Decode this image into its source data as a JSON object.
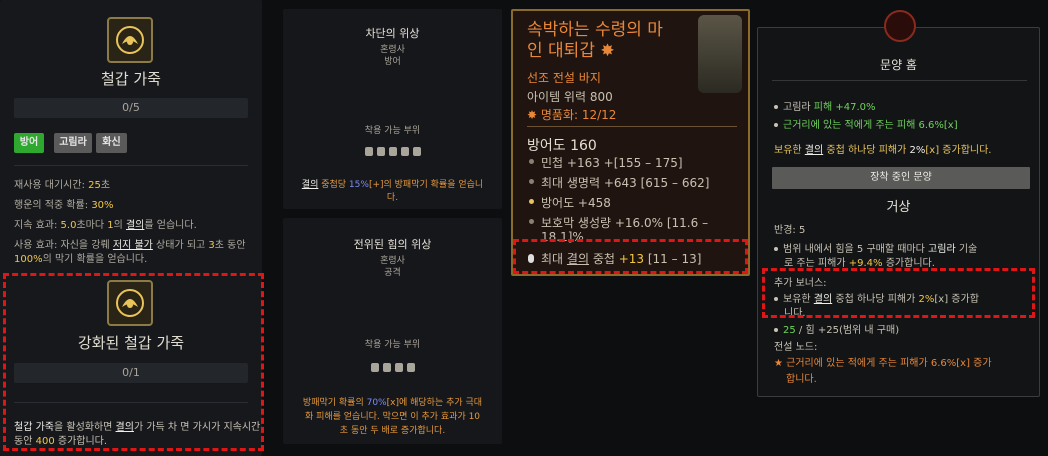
{
  "panel1": {
    "title": "철갑 가죽",
    "progress": "0/5",
    "tags": [
      "방어",
      "고림라",
      "화신"
    ],
    "cooldown_label": "재사용 대기시간: ",
    "cooldown_value": "25",
    "cooldown_unit": "초",
    "lucky_label": "행운의 적중 확률: ",
    "lucky_value": "30%",
    "duration_pre": "지속 효과: ",
    "duration_val": "5.0",
    "duration_mid": "초마다 ",
    "duration_num": "1",
    "duration_mid2": "의 ",
    "duration_kw": "결의",
    "duration_post": "를 얻습니다.",
    "active_line1_pre": "사용 효과: 자신을 강뤠 ",
    "active_line1_kw": "저지 불가",
    "active_line1_mid": " 상태가 되고 ",
    "active_line1_num": "3",
    "active_line1_post": "초 동안",
    "active_line2_val": "100%",
    "active_line2_post": "의 막기 확률을 얻습니다.",
    "upgrade_title": "강화된 철갑 가죽",
    "upgrade_progress": "0/1",
    "upgrade_line1_kw": "철갑 가죽",
    "upgrade_line1_mid": "을 활성화하면 ",
    "upgrade_line1_kw2": "결의",
    "upgrade_line1_post": "가 가득 차 면 가시가 지속시간",
    "upgrade_line2_pre": "동안 ",
    "upgrade_line2_val": "400",
    "upgrade_line2_post": " 증가합니다."
  },
  "panel2": {
    "title": "차단의 위상",
    "class": "혼령사",
    "slot": "방어",
    "equip_label": "착용 가능 부위",
    "desc1_kw": "결의",
    "desc1_mid": " 중첩당 ",
    "desc1_val": "15%",
    "desc1_bracket": "[+]",
    "desc1_post": "의 방패막기 확률을 얻습니",
    "desc2": "다."
  },
  "panel3": {
    "title": "전위된 힘의 위상",
    "class": "혼령사",
    "slot": "공격",
    "equip_label": "착용 가능 부위",
    "desc1_pre": "방패막기 확률의 ",
    "desc1_val": "70%",
    "desc1_post": "[x]에 해당하는 추가 극대",
    "desc2": "화 피해를 얻습니다. 막으면 이 추가 효과가 10",
    "desc3": "초 동안 두 배로 증가합니다."
  },
  "panel4": {
    "title_line1": "속박하는 수령의 마",
    "title_line2": "인 대퇴갑 ✸",
    "rarity": "선조 전설 바지",
    "power": "아이템 위력 800",
    "renown": "명품화: 12/12",
    "armor": "방어도 160",
    "stats": [
      "민첩 +163 +[155 – 175]",
      "최대 생명력 +643 [615 – 662]",
      "방어도 +458",
      "보호막 생성량 +16.0% [11.6 –",
      "18.1]%"
    ],
    "resolve_pre": "최대 ",
    "resolve_kw": "결의",
    "resolve_mid": " 중첩 ",
    "resolve_val": "+13",
    "resolve_range": " [11 – 13]"
  },
  "panel5": {
    "title": "문양 홈",
    "b1_pre": "고림라 ",
    "b1_post": "피해 +47.0%",
    "b2": "근거리에 있는 적에게 주는 피해 6.6%[x]",
    "owned_pre": "보유한 ",
    "owned_kw": "결의",
    "owned_mid": " 중첩 하나당 피해가 ",
    "owned_val": "2%",
    "owned_post": "[x] 증가합니다.",
    "button": "장착 중인 문양",
    "glyph_name": "거상",
    "radius": "반경: 5",
    "r1_pre": "범위 내에서 힘을 5 구매할 때마다 ",
    "r1_kw": "고림라",
    "r1_post": " 기술",
    "r2_pre": "로 주는 피해가 ",
    "r2_val": "+9.4%",
    "r2_post": " 증가합니다.",
    "bonus_label": "추가 보너스:",
    "bonus_pre": "보유한 ",
    "bonus_kw": "결의",
    "bonus_mid": " 중첩 하나당 피해가 ",
    "bonus_val": "2%",
    "bonus_post": "[x] 증가합",
    "bonus_line2": "니다.",
    "strength_val": "25",
    "strength_post": " / 힘 +25(범위 내 구매)",
    "legend_label": "전설 노드:",
    "legend1": "근거리에 있는 적에게 주는 피해가 6.6%[x] 증가",
    "legend2": "합니다."
  },
  "colors": {
    "highlight_red": "#e01616",
    "tag_green": "#2fa82f",
    "gold": "#f2c744",
    "legendary_orange": "#e98739"
  }
}
